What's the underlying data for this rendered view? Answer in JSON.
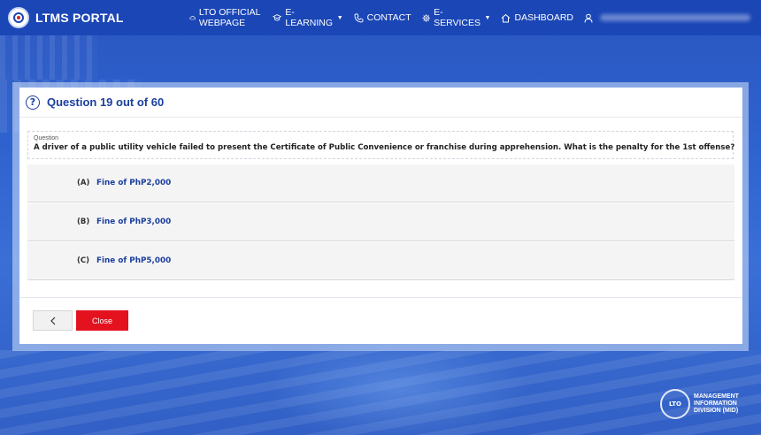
{
  "navbar": {
    "brand": "LTMS PORTAL",
    "items": [
      {
        "label": "LTO OFFICIAL WEBPAGE",
        "icon": "cloud-icon",
        "dropdown": false
      },
      {
        "label": "E-LEARNING",
        "icon": "graduation-cap-icon",
        "dropdown": true
      },
      {
        "label": "CONTACT",
        "icon": "phone-icon",
        "dropdown": false
      },
      {
        "label": "E-SERVICES",
        "icon": "gear-icon",
        "dropdown": true
      },
      {
        "label": "DASHBOARD",
        "icon": "home-icon",
        "dropdown": false
      }
    ],
    "user_icon": "user-icon"
  },
  "exam": {
    "title": "Question 19 out of 60",
    "question_label": "Question",
    "question_text": "A driver of a public utility vehicle failed to present the Certificate of Public Convenience or franchise during apprehension. What is the penalty for the 1st offense?",
    "options": [
      {
        "letter": "(A)",
        "text": "Fine of PhP2,000"
      },
      {
        "letter": "(B)",
        "text": "Fine of PhP3,000"
      },
      {
        "letter": "(C)",
        "text": "Fine of PhP5,000"
      }
    ],
    "close_label": "Close"
  },
  "mid_logo": {
    "emblem": "LTO",
    "line1": "MANAGEMENT",
    "line2": "INFORMATION",
    "line3": "DIVISION (MID)"
  },
  "colors": {
    "navbar": "#1b46b6",
    "accent": "#1b3f9e",
    "close_button": "#e3121e"
  }
}
